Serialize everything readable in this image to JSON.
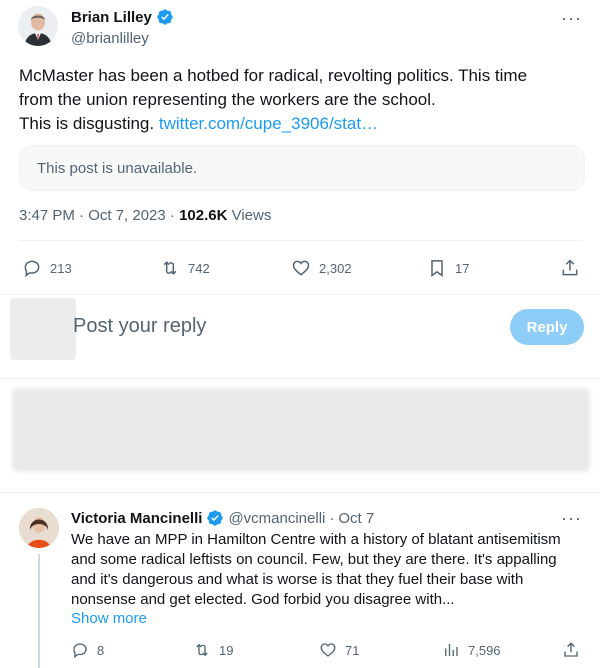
{
  "tweet": {
    "author_name": "Brian Lilley",
    "handle": "@brianlilley",
    "more": "···",
    "text_lines": [
      "McMaster has been a hotbed for radical, revolting politics. This time",
      "from the union representing the workers are the school.",
      "This is disgusting. "
    ],
    "link": "twitter.com/cupe_3906/stat…",
    "quote_unavailable": "This post is unavailable.",
    "time": "3:47 PM · Oct 7, 2023 · ",
    "views_count": "102.6K",
    "views_label": " Views",
    "actions": {
      "replies": "213",
      "retweets": "742",
      "likes": "2,302",
      "bookmarks": "17"
    },
    "icons": [
      "verified-badge-icon",
      "reply-icon",
      "retweet-icon",
      "like-icon",
      "bookmark-icon",
      "share-icon"
    ],
    "accent_color": "#1d9bf0"
  },
  "reply_box": {
    "placeholder": "Post your reply",
    "button": "Reply"
  },
  "reply_tweet": {
    "author_name": "Victoria Mancinelli",
    "handle": "@vcmancinelli",
    "dot": "·",
    "date": "Oct 7",
    "more": "···",
    "text_lines": [
      "We have an MPP in Hamilton Centre with a history of blatant antisemitism",
      "and some radical leftists on council. Few, but they are there. It's appalling",
      "and it's dangerous and what is worse is that they fuel their base with",
      "nonsense and get elected. God forbid you disagree with..."
    ],
    "show_more": "Show more",
    "actions": {
      "replies": "8",
      "retweets": "19",
      "likes": "71",
      "views": "7,596"
    }
  }
}
